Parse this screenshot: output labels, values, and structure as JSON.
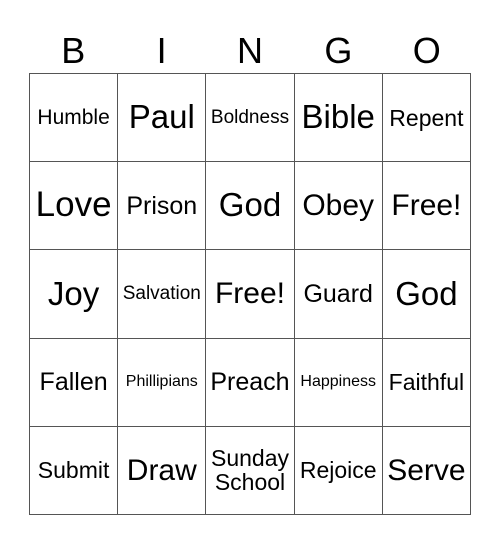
{
  "header": [
    "B",
    "I",
    "N",
    "G",
    "O"
  ],
  "rows": [
    [
      "Humble",
      "Paul",
      "Boldness",
      "Bible",
      "Repent"
    ],
    [
      "Love",
      "Prison",
      "God",
      "Obey",
      "Free!"
    ],
    [
      "Joy",
      "Salvation",
      "Free!",
      "Guard",
      "God"
    ],
    [
      "Fallen",
      "Phillipians",
      "Preach",
      "Happiness",
      "Faithful"
    ],
    [
      "Submit",
      "Draw",
      "Sunday School",
      "Rejoice",
      "Serve"
    ]
  ]
}
